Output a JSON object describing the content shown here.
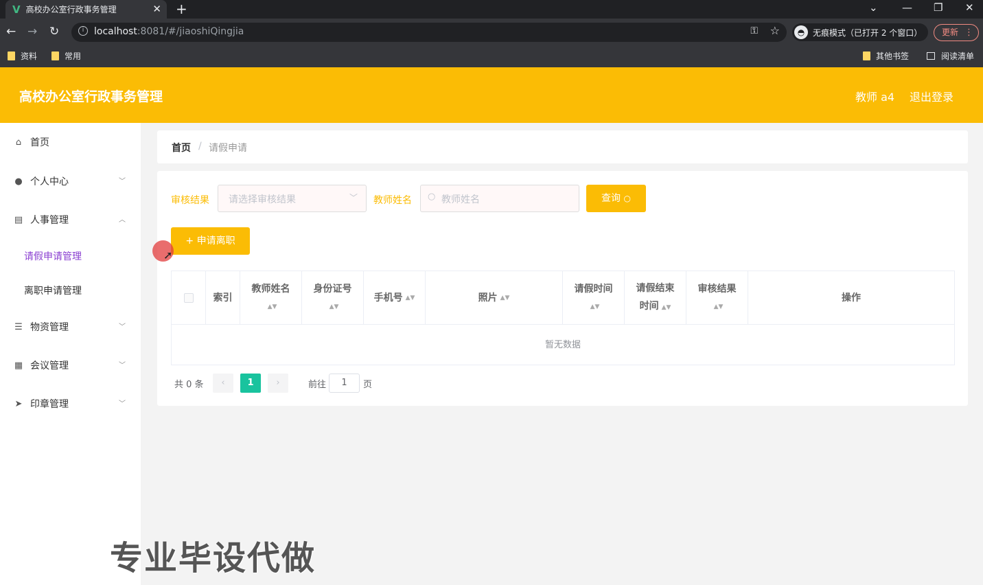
{
  "browser": {
    "tab_title": "高校办公室行政事务管理",
    "url_host": "localhost",
    "url_rest": ":8081/#/jiaoshiQingjia",
    "incognito_label": "无痕模式（已打开 2 个窗口）",
    "update_label": "更新",
    "bookmarks": [
      "资料",
      "常用"
    ],
    "other_bookmarks": "其他书签",
    "reading_list": "阅读清单"
  },
  "header": {
    "title": "高校办公室行政事务管理",
    "user": "教师 a4",
    "logout": "退出登录",
    "accent_color": "#fbbc05"
  },
  "sidebar": {
    "items": [
      {
        "label": "首页",
        "icon": "home-icon"
      },
      {
        "label": "个人中心",
        "icon": "user-icon"
      },
      {
        "label": "人事管理",
        "icon": "clipboard-icon"
      },
      {
        "label": "物资管理",
        "icon": "list-icon"
      },
      {
        "label": "会议管理",
        "icon": "calendar-icon"
      },
      {
        "label": "印章管理",
        "icon": "paper-plane-icon"
      }
    ],
    "sub_items": [
      "请假申请管理",
      "离职申请管理"
    ],
    "active_sub": "请假申请管理"
  },
  "breadcrumb": {
    "home": "首页",
    "current": "请假申请"
  },
  "filters": {
    "result_label": "审核结果",
    "result_placeholder": "请选择审核结果",
    "name_label": "教师姓名",
    "name_placeholder": "教师姓名",
    "query_button": "查询",
    "apply_button": "申请离职"
  },
  "table": {
    "columns": [
      "索引",
      "教师姓名",
      "身份证号",
      "手机号",
      "照片",
      "请假时间",
      "请假结束时间",
      "审核结果",
      "操作"
    ],
    "column_lines": {
      "c6a": "请假结束",
      "c6b": "时间"
    },
    "empty_text": "暂无数据"
  },
  "pagination": {
    "total_text": "共 0 条",
    "current_page": "1",
    "goto_label": "前往",
    "goto_value": "1",
    "page_suffix": "页"
  },
  "watermark": "专业毕设代做"
}
